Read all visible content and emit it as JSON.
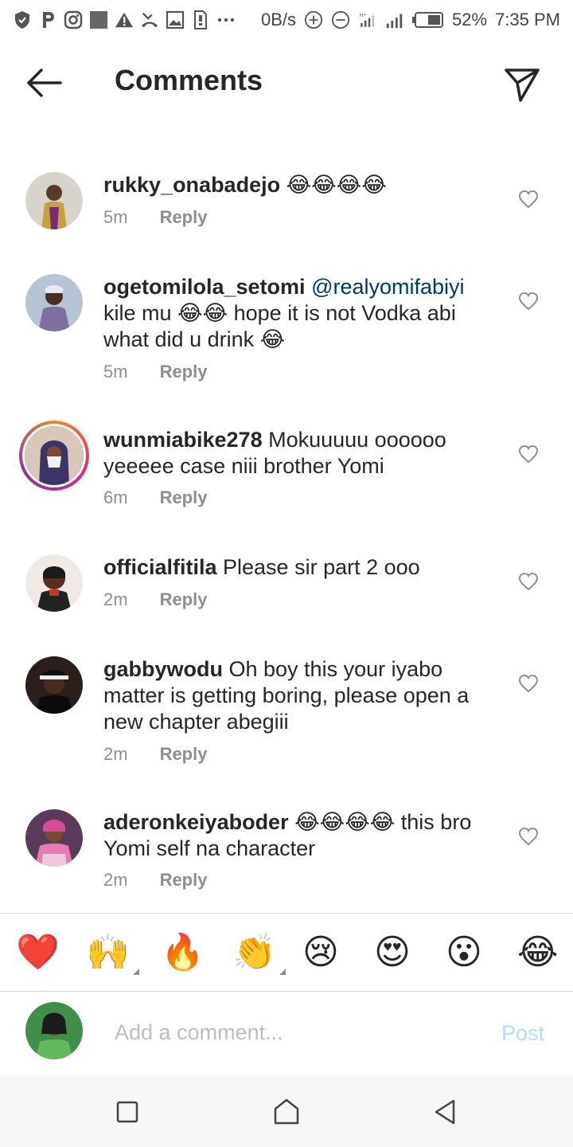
{
  "status_bar": {
    "net_speed": "0B/s",
    "battery": "52%",
    "time": "7:35 PM",
    "icons": [
      "shield-icon",
      "p-app-icon",
      "instagram-icon",
      "square-icon",
      "warning-icon",
      "missed-call-icon",
      "image-icon",
      "sim-icon",
      "more-dots-icon",
      "add-circle-icon",
      "minus-circle-icon",
      "signal-icon",
      "signal-icon",
      "battery-icon"
    ]
  },
  "header": {
    "title": "Comments",
    "back_icon": "arrow-left-icon",
    "send_icon": "paper-plane-icon"
  },
  "comments": [
    {
      "username": "rukky_onabadejo",
      "mention": "",
      "text": " 😂😂😂😂",
      "time": "5m",
      "reply_label": "Reply",
      "has_story_ring": false,
      "avatar_color": "#c9a86a"
    },
    {
      "username": "ogetomilola_setomi",
      "mention": "@realyomifabiyi",
      "text": "kile mu 😂😂 hope it is not Vodka abi what did u drink 😂",
      "time": "5m",
      "reply_label": "Reply",
      "has_story_ring": false,
      "avatar_color": "#8a7f9e"
    },
    {
      "username": "wunmiabike278",
      "mention": "",
      "text": " Mokuuuuu oooooo yeeeee case niii brother Yomi",
      "time": "6m",
      "reply_label": "Reply",
      "has_story_ring": true,
      "avatar_color": "#3c3a6a"
    },
    {
      "username": "officialfitila",
      "mention": "",
      "text": " Please sir  part 2 ooo",
      "time": "2m",
      "reply_label": "Reply",
      "has_story_ring": false,
      "avatar_color": "#6b3a2a"
    },
    {
      "username": "gabbywodu",
      "mention": "",
      "text": " Oh boy this your iyabo matter is getting boring, please open a new chapter abegiii",
      "time": "2m",
      "reply_label": "Reply",
      "has_story_ring": false,
      "avatar_color": "#2a1f1a"
    },
    {
      "username": "aderonkeiyaboder",
      "mention": "",
      "text": " 😂😂😂😂 this bro Yomi self na character",
      "time": "2m",
      "reply_label": "Reply",
      "has_story_ring": false,
      "avatar_color": "#b84a8a"
    }
  ],
  "emoji_bar": [
    "❤️",
    "🙌",
    "🔥",
    "👏",
    "😢",
    "😍",
    "😮",
    "😂"
  ],
  "add_comment": {
    "placeholder": "Add a comment...",
    "post_label": "Post",
    "avatar_color": "#2f7a3a"
  },
  "nav_bar": {
    "icons": [
      "square-recents-icon",
      "home-icon",
      "triangle-back-icon"
    ]
  },
  "colors": {
    "text": "#262626",
    "meta": "#8e8e8e",
    "mention": "#00376b",
    "post_disabled": "#b3dbff"
  }
}
